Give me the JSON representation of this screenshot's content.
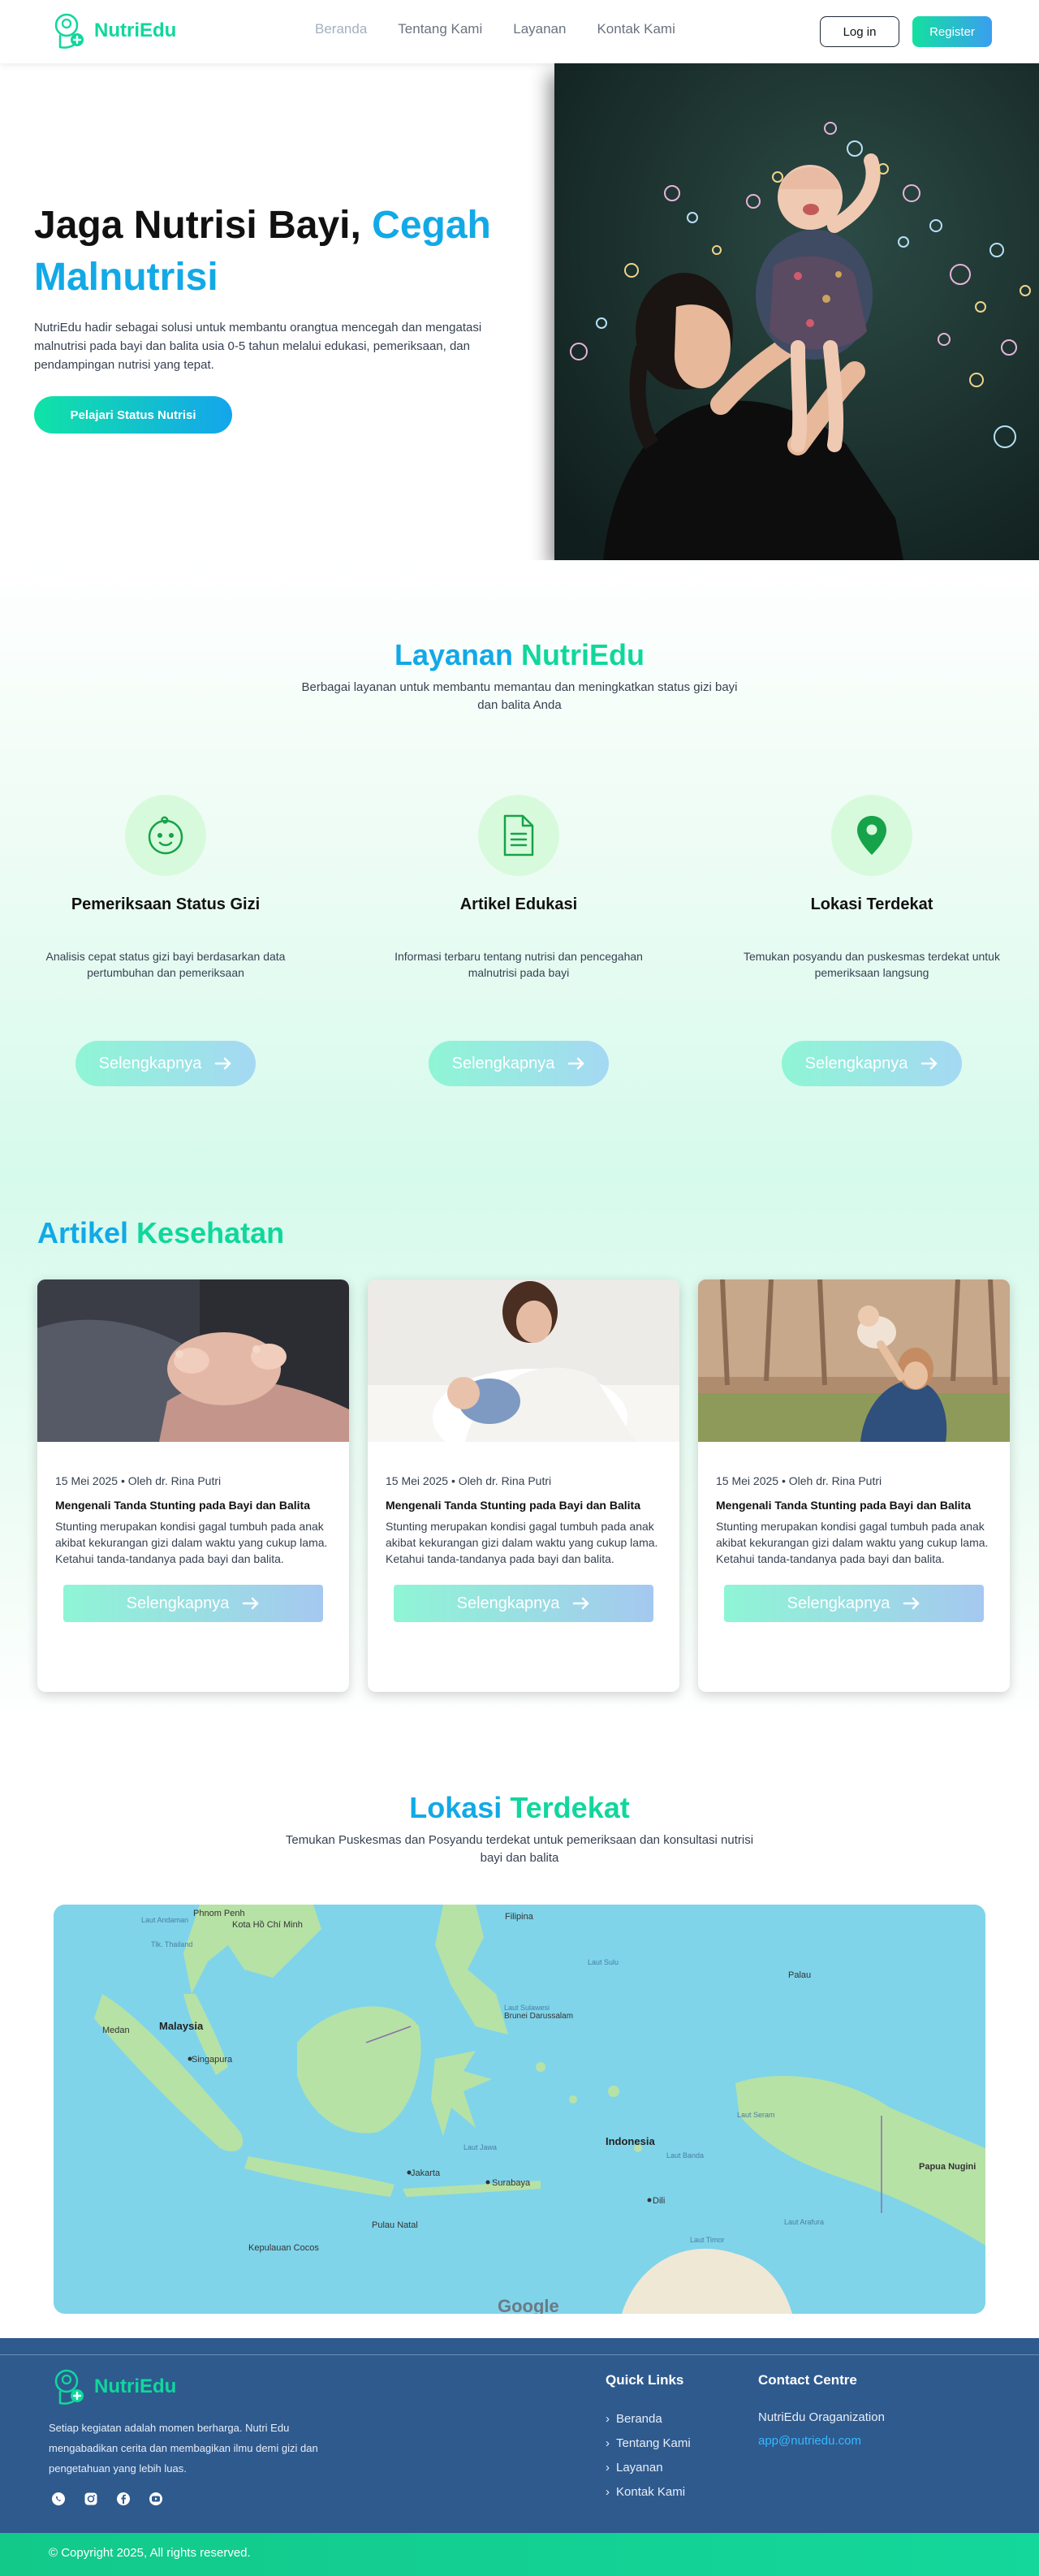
{
  "nav": {
    "brand": "NutriEdu",
    "links": [
      "Beranda",
      "Tentang Kami",
      "Layanan",
      "Kontak Kami"
    ],
    "login": "Log in",
    "register": "Register"
  },
  "hero": {
    "title_part1": "Jaga Nutrisi Bayi, ",
    "title_accent": "Cegah Malnutrisi",
    "description": "NutriEdu hadir sebagai solusi untuk membantu orangtua mencegah dan mengatasi malnutrisi pada bayi dan balita usia 0-5 tahun melalui edukasi, pemeriksaan, dan pendampingan nutrisi yang tepat.",
    "cta": "Pelajari Status Nutrisi"
  },
  "services": {
    "title_part1": "Layanan ",
    "title_part2": "NutriEdu",
    "subtitle": "Berbagai layanan untuk membantu memantau dan meningkatkan status gizi bayi dan balita Anda",
    "items": [
      {
        "icon": "baby-face-icon",
        "title": "Pemeriksaan Status Gizi",
        "desc": "Analisis cepat status gizi bayi berdasarkan data pertumbuhan dan pemeriksaan",
        "button": "Selengkapnya"
      },
      {
        "icon": "document-icon",
        "title": "Artikel Edukasi",
        "desc": "Informasi terbaru tentang nutrisi dan pencegahan malnutrisi pada bayi",
        "button": "Selengkapnya"
      },
      {
        "icon": "location-pin-icon",
        "title": "Lokasi Terdekat",
        "desc": "Temukan posyandu dan puskesmas terdekat untuk pemeriksaan langsung",
        "button": "Selengkapnya"
      }
    ]
  },
  "articles": {
    "title_part1": "Artikel ",
    "title_part2": "Kesehatan",
    "items": [
      {
        "meta": "15 Mei 2025 • Oleh dr. Rina Putri",
        "title": "Mengenali Tanda Stunting pada Bayi dan Balita",
        "text": "Stunting merupakan kondisi gagal tumbuh pada anak akibat kekurangan gizi dalam waktu yang cukup lama. Ketahui tanda-tandanya pada bayi dan balita.",
        "button": "Selengkapnya"
      },
      {
        "meta": "15 Mei 2025 • Oleh dr. Rina Putri",
        "title": "Mengenali Tanda Stunting pada Bayi dan Balita",
        "text": "Stunting merupakan kondisi gagal tumbuh pada anak akibat kekurangan gizi dalam waktu yang cukup lama. Ketahui tanda-tandanya pada bayi dan balita.",
        "button": "Selengkapnya"
      },
      {
        "meta": "15 Mei 2025 • Oleh dr. Rina Putri",
        "title": "Mengenali Tanda Stunting pada Bayi dan Balita",
        "text": "Stunting merupakan kondisi gagal tumbuh pada anak akibat kekurangan gizi dalam waktu yang cukup lama. Ketahui tanda-tandanya pada bayi dan balita.",
        "button": "Selengkapnya"
      }
    ]
  },
  "location": {
    "title_part1": "Lokasi ",
    "title_part2": "Terdekat",
    "subtitle": "Temukan Puskesmas dan Posyandu terdekat untuk pemeriksaan dan konsultasi nutrisi bayi dan balita",
    "map_labels": {
      "phnom_penh": "Phnom Penh",
      "hcmc": "Kota Hồ Chí Minh",
      "gulf": "Tlk. Thailand",
      "malaysia": "Malaysia",
      "medan": "Medan",
      "singapura": "Singapura",
      "brunei": "Brunei Darussalam",
      "indonesia": "Indonesia",
      "jakarta": "Jakarta",
      "surabaya": "Surabaya",
      "dili": "Dili",
      "papua": "Papua Nugini",
      "palau": "Palau",
      "pulau_natal": "Pulau Natal",
      "kepulauan_cocos": "Kepulauan Cocos",
      "laut_jawa": "Laut Jawa",
      "laut_banda": "Laut Banda",
      "laut_sulu": "Laut Sulu",
      "laut_sulawesi": "Laut Sulawesi",
      "laut_timor": "Laut Timor",
      "laut_andaman": "Laut Andaman",
      "laut_seram": "Laut Seram",
      "laut_arafura": "Laut Arafura",
      "filipina": "Filipina",
      "google": "Google"
    }
  },
  "footer": {
    "brand": "NutriEdu",
    "description": "Setiap kegiatan adalah momen berharga. Nutri Edu mengabadikan cerita dan membagikan ilmu demi gizi dan pengetahuan yang lebih luas.",
    "quick_links_title": "Quick Links",
    "quick_links": [
      "Beranda",
      "Tentang Kami",
      "Layanan",
      "Kontak Kami"
    ],
    "contact_title": "Contact Centre",
    "contact_org": "NutriEdu Oraganization",
    "contact_email": "app@nutriedu.com",
    "copyright": "© Copyright 2025, All rights reserved."
  }
}
